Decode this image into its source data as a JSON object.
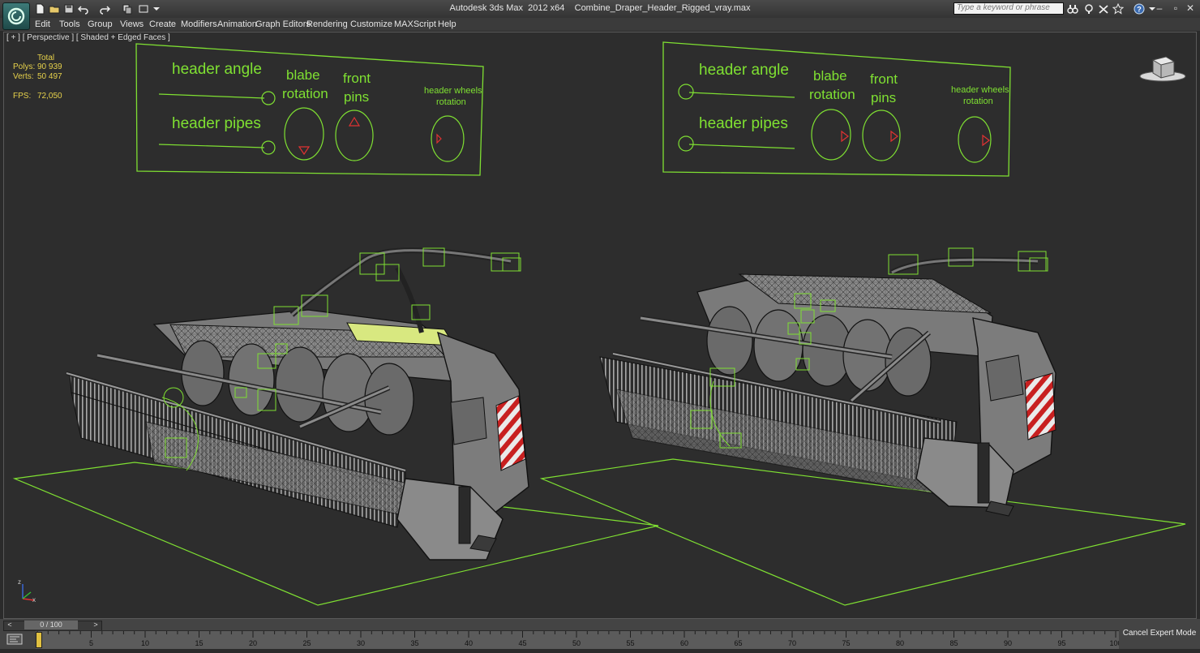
{
  "title_bar": {
    "app_name": "Autodesk 3ds Max  2012 x64",
    "file_name": "Combine_Draper_Header_Rigged_vray.max",
    "search_placeholder": "Type a keyword or phrase",
    "minimize": "–",
    "maximize": "▫",
    "close": "✕"
  },
  "menu": {
    "items": [
      "Edit",
      "Tools",
      "Group",
      "Views",
      "Create",
      "Modifiers",
      "Animation",
      "Graph Editors",
      "Rendering",
      "Customize",
      "MAXScript",
      "Help"
    ]
  },
  "viewport": {
    "label": "[ + ] [ Perspective ] [ Shaded + Edged Faces ]",
    "stats": {
      "total_label": "Total",
      "polys_label": "Polys:",
      "polys_value": "90 939",
      "verts_label": "Verts:",
      "verts_value": "50 497",
      "fps_label": "FPS:",
      "fps_value": "72,050"
    },
    "left_panel": {
      "header_angle": "header angle",
      "header_pipes": "header pipes",
      "blabe": "blabe",
      "rotation": "rotation",
      "front": "front",
      "pins": "pins",
      "wheels_1": "header wheels",
      "wheels_2": "rotation"
    },
    "right_panel": {
      "header_angle": "header angle",
      "header_pipes": "header pipes",
      "blabe": "blabe",
      "rotation": "rotation",
      "front": "front",
      "pins": "pins",
      "wheels_1": "header wheels",
      "wheels_2": "rotation"
    },
    "axis": {
      "z": "z",
      "x": "x"
    },
    "colors": {
      "wire": "#7fe032",
      "handle": "#e03232",
      "stats": "#e6d14b"
    }
  },
  "timeline": {
    "slider": "0 / 100",
    "prev": "<",
    "next": ">",
    "ticks": [
      "0",
      "5",
      "10",
      "15",
      "20",
      "25",
      "30",
      "35",
      "40",
      "45",
      "50",
      "55",
      "60",
      "65",
      "70",
      "75",
      "80",
      "85",
      "90",
      "95",
      "100"
    ],
    "current_frame": 0,
    "total_frames": 100,
    "cancel_expert": "Cancel Expert Mode"
  }
}
